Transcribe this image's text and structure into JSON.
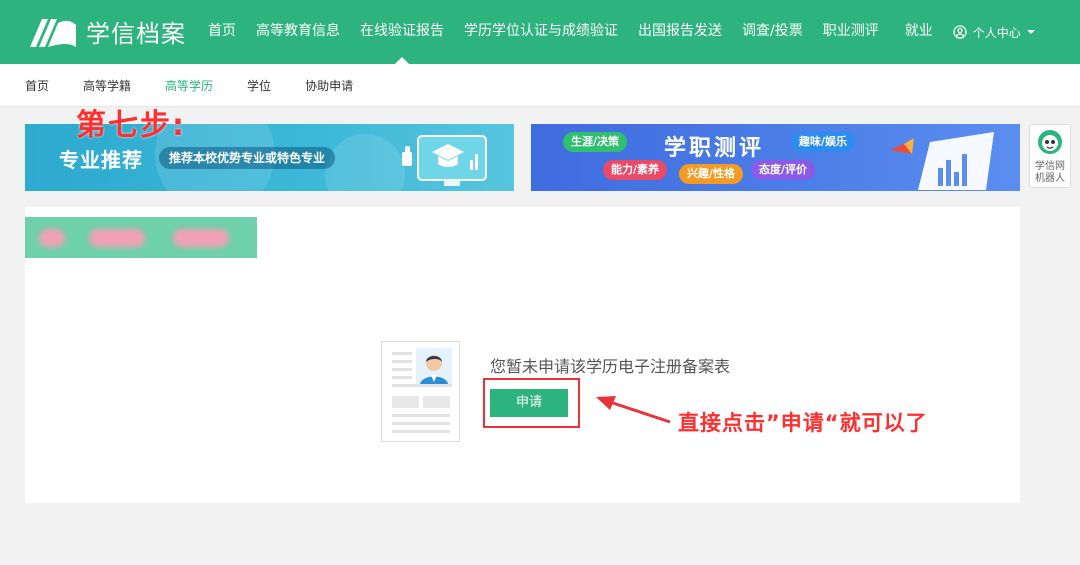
{
  "header": {
    "logo_text": "学信档案",
    "nav": [
      {
        "label": "首页"
      },
      {
        "label": "高等教育信息"
      },
      {
        "label": "在线验证报告"
      },
      {
        "label": "学历学位认证与成绩验证"
      },
      {
        "label": "出国报告发送"
      },
      {
        "label": "调查/投票"
      },
      {
        "label": "职业测评"
      },
      {
        "label": "就业"
      }
    ],
    "user_menu_label": "个人中心",
    "active_nav_index": 2
  },
  "subnav": {
    "items": [
      {
        "label": "首页"
      },
      {
        "label": "高等学籍"
      },
      {
        "label": "高等学历"
      },
      {
        "label": "学位"
      },
      {
        "label": "协助申请"
      }
    ],
    "active_index": 2
  },
  "banners": {
    "left": {
      "title": "专业推荐",
      "pill": "推荐本校优势专业或特色专业"
    },
    "right": {
      "title": "学职测评",
      "tags": [
        "生涯/决策",
        "趣味/娱乐",
        "能力/素养",
        "兴趣/性格",
        "态度/评价"
      ]
    }
  },
  "robot": {
    "line1": "学信网",
    "line2": "机器人"
  },
  "overlay": {
    "step_label": "第七步:",
    "annotation": "直接点击”申请“就可以了"
  },
  "main": {
    "empty_message": "您暂未申请该学历电子注册备案表",
    "apply_button_label": "申请"
  },
  "colors": {
    "brand": "#2db37d",
    "annotation_red": "#ff2f2f"
  }
}
